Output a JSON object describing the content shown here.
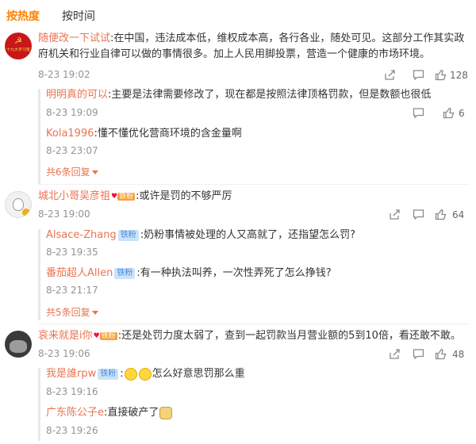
{
  "tabs": [
    {
      "label": "按热度"
    },
    {
      "label": "按时间"
    }
  ],
  "comments": [
    {
      "user": "随便改一下试试",
      "avatar_text": "十九大学习笔记本",
      "text": "在中国，违法成本低，维权成本高，各行各业，随处可见。这部分工作其实政府机关和行业自律可以做的事情很多。加上人民用脚投票，营造一个健康的市场环境。",
      "time": "8-23 19:02",
      "likes": "128",
      "replies": [
        {
          "user": "明明真的可以",
          "text": "主要是法律需要修改了，现在都是按照法律顶格罚款，但是数额也很低",
          "time": "8-23 19:09",
          "likes": "6"
        },
        {
          "user": "Kola1996",
          "text": "懂不懂优化营商环境的含金量啊",
          "time": "8-23 23:07"
        }
      ],
      "more": "共6条回复"
    },
    {
      "user": "城北小哥吴彦祖",
      "badge": "铁粉",
      "text": "或许是罚的不够严厉",
      "time": "8-23 19:00",
      "likes": "64",
      "replies": [
        {
          "user": "Alsace-Zhang",
          "tag": "铁粉",
          "text": "奶粉事情被处理的人又高就了，还指望怎么罚?",
          "time": "8-23 19:35"
        },
        {
          "user": "番茄超人Allen",
          "tag": "铁粉",
          "text": "有一种执法叫养，一次性弄死了怎么挣钱?",
          "time": "8-23 21:17"
        }
      ],
      "more": "共5条回复"
    },
    {
      "user": "哀来就是i你",
      "badge": "铁粉",
      "text": "还是处罚力度太弱了，查到一起罚款当月营业额的5到10倍，看还敢不敢。",
      "time": "8-23 19:06",
      "likes": "48",
      "replies": [
        {
          "user": "我是誰rpw",
          "tag": "铁粉",
          "text": "怎么好意思罚那么重",
          "time": "8-23 19:16"
        },
        {
          "user": "广东陈公子e",
          "text": "直接破产了",
          "time": "8-23 19:26"
        }
      ]
    }
  ],
  "icons": {
    "share": "share-icon",
    "comment": "comment-icon",
    "like": "thumbs-up-icon"
  },
  "colors": {
    "accent": "#ff8200",
    "username": "#eb7350",
    "meta": "#939393",
    "tag_bg": "#cae3f8",
    "tag_text": "#4a8ad8"
  }
}
